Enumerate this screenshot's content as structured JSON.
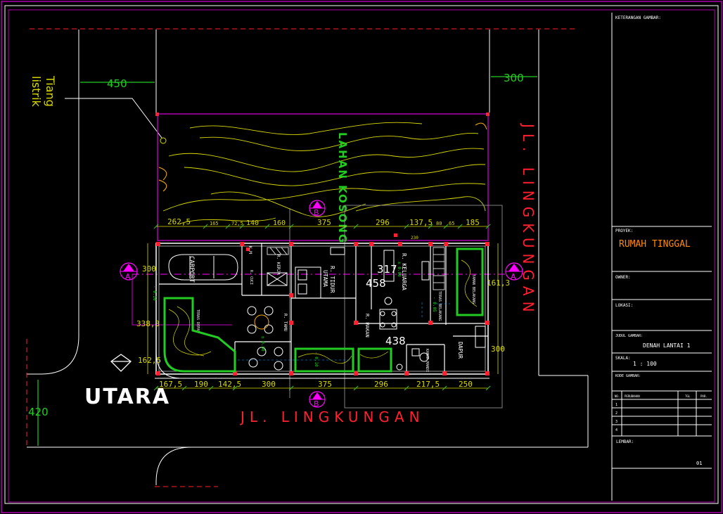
{
  "colors": {
    "frame": "#b000b0",
    "white": "#ffffff",
    "green": "#22cc22",
    "yellow": "#d8d800",
    "red": "#ff2030",
    "magenta": "#ff00ff",
    "orange": "#ff8a00",
    "grey": "#b0b0b0",
    "cyan": "#00a8ff"
  },
  "title_block": {
    "keterangan_label": "KETERANGAN GAMBAR:",
    "proyek_label": "PROYEK:",
    "proyek_value": "RUMAH TINGGAL",
    "owner_label": "OWNER:",
    "lokasi_label": "LOKASI:",
    "judul_label": "JUDUL GAMBAR:",
    "judul_value": "DENAH LANTAI 1",
    "skala_label": "SKALA:",
    "skala_value": "1 : 100",
    "kode_label": "KODE GAMBAR:",
    "rev_headers": [
      "NO.",
      "PERUBAHAN",
      "TGL",
      "PAR."
    ],
    "rev_rows": [
      "1",
      "2",
      "3",
      "4"
    ],
    "lembar_label": "LEMBAR:",
    "lembar_value": "01"
  },
  "site": {
    "street_right": "JL. LINGKUNGAN",
    "street_bottom": "JL. LINGKUNGAN",
    "empty_lot": "LAHAN KOSONG",
    "pole_label_1": "Tiang",
    "pole_label_2": "listrik",
    "north_label": "UTARA",
    "dim_left_setback": "450",
    "dim_right_setback": "300",
    "dim_bottom_left": "420"
  },
  "dims_top": [
    "262,5",
    "165",
    "72,5",
    "140",
    "160",
    "375",
    "296",
    "137,5",
    "80",
    "65",
    "185",
    "230"
  ],
  "dims_bottom": [
    "167,5",
    "190",
    "142,5",
    "300",
    "375",
    "296",
    "217,5",
    "250"
  ],
  "dims_side": [
    "300",
    "338,3",
    "162,5",
    "161,3",
    "300"
  ],
  "dims_inner": [
    "317",
    "458",
    "438"
  ],
  "section_markers": [
    "A",
    "A",
    "B",
    "B"
  ],
  "rooms": {
    "carport": "CARPORT",
    "r_tidur_utama_1": "R. TIDUR",
    "r_tidur_utama_2": "UTAMA",
    "r_keluarga": "R. KELUARGA",
    "r_makan": "R. MAKAN",
    "dapur": "DAPUR",
    "r_tamu": "R. TAMU",
    "teras_belakang": "TERAS BELAKANG",
    "teras_depan": "TERAS DEPAN",
    "taman_belakang": "TAMAN BELAKANG",
    "r_cuci": "R. CUCI",
    "r_kerja": "R. KERJA",
    "kamar_mandi": "KAMAR MANDI",
    "km": "K.M",
    "level_a": "± 0.00",
    "level_b": "- 0.05",
    "level_c": "- 0.10",
    "level_d": "- 0.20"
  }
}
